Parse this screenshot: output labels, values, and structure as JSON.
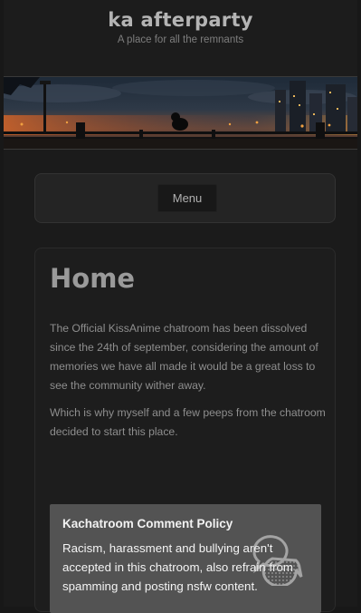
{
  "site": {
    "title": "ka afterparty",
    "tagline": "A place for all the remnants"
  },
  "banner": {
    "icon": "city-night-banner-image"
  },
  "nav": {
    "menu_label": "Menu"
  },
  "page": {
    "title": "Home",
    "paragraphs": [
      "The Official KissAnime chatroom has been dissolved since the 24th of september, considering the amount of memories we have all made it would be a great loss to see the community wither away.",
      "Which is why myself and a few peeps from the chatroom decided to start this place."
    ]
  },
  "policy": {
    "title": "Kachatroom Comment Policy",
    "body": "Racism, harassment and bullying aren't accepted in this chatroom, also refrain from spamming and posting nsfw content.",
    "icon": "chat-bubbles-icon"
  },
  "colors": {
    "background": "#1b1b1b",
    "card": "#1d1d1d",
    "policy_box": "#535353"
  }
}
